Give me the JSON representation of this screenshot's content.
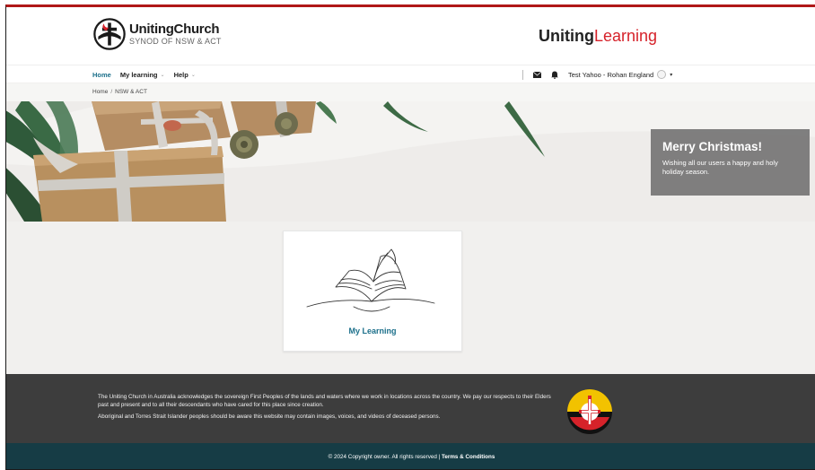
{
  "header": {
    "church_name": "UnitingChurch",
    "church_subtitle": "SYNOD OF NSW & ACT",
    "learning_logo_part1": "Uniting",
    "learning_logo_part2": "Learning"
  },
  "nav": {
    "items": [
      {
        "label": "Home",
        "active": true,
        "has_dropdown": false
      },
      {
        "label": "My learning",
        "active": false,
        "has_dropdown": true
      },
      {
        "label": "Help",
        "active": false,
        "has_dropdown": true
      }
    ],
    "user_name": "Test Yahoo - Rohan England",
    "icons": [
      "mail-icon",
      "bell-icon",
      "user-avatar-icon",
      "chevron-down-icon"
    ]
  },
  "breadcrumb": [
    "Home",
    "NSW & ACT"
  ],
  "banner": {
    "title": "Merry Christmas!",
    "text": "Wishing all our users a happy and holy holiday season."
  },
  "card": {
    "title": "My Learning"
  },
  "footer": {
    "acknowledgement": "The Uniting Church in Australia acknowledges the sovereign First Peoples of the lands and waters where we work in locations across the country. We pay our respects to their Elders past and present and to all their descendants who have cared for this place since creation.",
    "warning": "Aboriginal and Torres Strait Islander peoples should be aware this website may contain images, voices, and videos of deceased persons."
  },
  "copyright": {
    "text": "© 2024 Copyright owner. All rights reserved | ",
    "terms_label": "Terms & Conditions"
  },
  "colors": {
    "accent_red": "#d6222a",
    "link_teal": "#1b6f8a",
    "footer_dark": "#3d3d3d",
    "copyright_bar": "#163c45"
  }
}
